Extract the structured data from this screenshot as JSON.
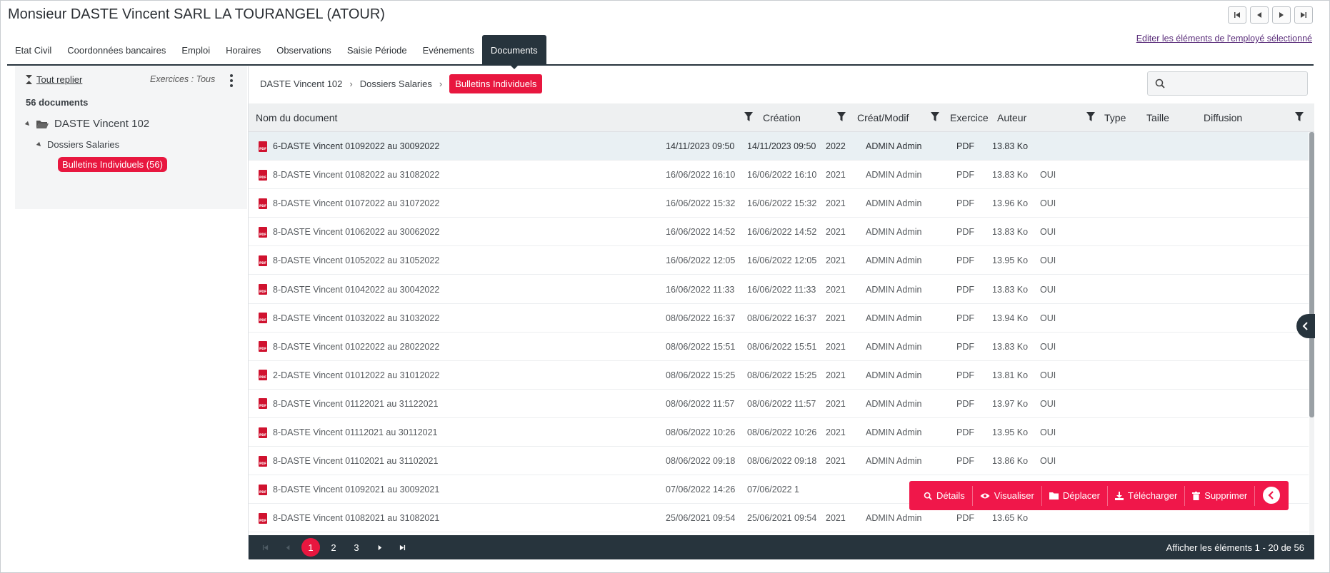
{
  "header": {
    "title": "Monsieur DASTE Vincent SARL LA TOURANGEL (ATOUR)",
    "edit_link": "Editer les éléments de l'employé sélectionné"
  },
  "tabs": [
    {
      "label": "Etat Civil"
    },
    {
      "label": "Coordonnées bancaires"
    },
    {
      "label": "Emploi"
    },
    {
      "label": "Horaires"
    },
    {
      "label": "Observations"
    },
    {
      "label": "Saisie Période"
    },
    {
      "label": "Evénements"
    },
    {
      "label": "Documents",
      "active": true
    }
  ],
  "left_panel": {
    "collapse_label": "Tout replier",
    "exercices_label": "Exercices : Tous",
    "doc_count": "56 documents",
    "tree": {
      "root": "DASTE Vincent 102",
      "child": "Dossiers Salaries",
      "leaf": "Bulletins Individuels (56)"
    }
  },
  "breadcrumb": {
    "items": [
      "DASTE Vincent 102",
      "Dossiers Salaries"
    ],
    "active": "Bulletins Individuels"
  },
  "search": {
    "value": "",
    "placeholder": ""
  },
  "table": {
    "columns": {
      "name": "Nom du document",
      "creation": "Création",
      "modif": "Créat/Modif",
      "exercice": "Exercice",
      "auteur": "Auteur",
      "type": "Type",
      "taille": "Taille",
      "diffusion": "Diffusion"
    },
    "rows": [
      {
        "name": "6-DASTE Vincent 01092022 au 30092022",
        "creation": "14/11/2023 09:50",
        "modif": "14/11/2023 09:50",
        "exercice": "2022",
        "auteur": "ADMIN Admin",
        "type": "PDF",
        "taille": "13.83 Ko",
        "diffusion": ""
      },
      {
        "name": "8-DASTE Vincent 01082022 au 31082022",
        "creation": "16/06/2022 16:10",
        "modif": "16/06/2022 16:10",
        "exercice": "2021",
        "auteur": "ADMIN Admin",
        "type": "PDF",
        "taille": "13.83 Ko",
        "diffusion": "OUI"
      },
      {
        "name": "8-DASTE Vincent 01072022 au 31072022",
        "creation": "16/06/2022 15:32",
        "modif": "16/06/2022 15:32",
        "exercice": "2021",
        "auteur": "ADMIN Admin",
        "type": "PDF",
        "taille": "13.96 Ko",
        "diffusion": "OUI"
      },
      {
        "name": "8-DASTE Vincent 01062022 au 30062022",
        "creation": "16/06/2022 14:52",
        "modif": "16/06/2022 14:52",
        "exercice": "2021",
        "auteur": "ADMIN Admin",
        "type": "PDF",
        "taille": "13.83 Ko",
        "diffusion": "OUI"
      },
      {
        "name": "8-DASTE Vincent 01052022 au 31052022",
        "creation": "16/06/2022 12:05",
        "modif": "16/06/2022 12:05",
        "exercice": "2021",
        "auteur": "ADMIN Admin",
        "type": "PDF",
        "taille": "13.95 Ko",
        "diffusion": "OUI"
      },
      {
        "name": "8-DASTE Vincent 01042022 au 30042022",
        "creation": "16/06/2022 11:33",
        "modif": "16/06/2022 11:33",
        "exercice": "2021",
        "auteur": "ADMIN Admin",
        "type": "PDF",
        "taille": "13.83 Ko",
        "diffusion": "OUI"
      },
      {
        "name": "8-DASTE Vincent 01032022 au 31032022",
        "creation": "08/06/2022 16:37",
        "modif": "08/06/2022 16:37",
        "exercice": "2021",
        "auteur": "ADMIN Admin",
        "type": "PDF",
        "taille": "13.94 Ko",
        "diffusion": "OUI"
      },
      {
        "name": "8-DASTE Vincent 01022022 au 28022022",
        "creation": "08/06/2022 15:51",
        "modif": "08/06/2022 15:51",
        "exercice": "2021",
        "auteur": "ADMIN Admin",
        "type": "PDF",
        "taille": "13.83 Ko",
        "diffusion": "OUI"
      },
      {
        "name": "2-DASTE Vincent 01012022 au 31012022",
        "creation": "08/06/2022 15:25",
        "modif": "08/06/2022 15:25",
        "exercice": "2021",
        "auteur": "ADMIN Admin",
        "type": "PDF",
        "taille": "13.81 Ko",
        "diffusion": "OUI"
      },
      {
        "name": "8-DASTE Vincent 01122021 au 31122021",
        "creation": "08/06/2022 11:57",
        "modif": "08/06/2022 11:57",
        "exercice": "2021",
        "auteur": "ADMIN Admin",
        "type": "PDF",
        "taille": "13.97 Ko",
        "diffusion": "OUI"
      },
      {
        "name": "8-DASTE Vincent 01112021 au 30112021",
        "creation": "08/06/2022 10:26",
        "modif": "08/06/2022 10:26",
        "exercice": "2021",
        "auteur": "ADMIN Admin",
        "type": "PDF",
        "taille": "13.95 Ko",
        "diffusion": "OUI"
      },
      {
        "name": "8-DASTE Vincent 01102021 au 31102021",
        "creation": "08/06/2022 09:18",
        "modif": "08/06/2022 09:18",
        "exercice": "2021",
        "auteur": "ADMIN Admin",
        "type": "PDF",
        "taille": "13.86 Ko",
        "diffusion": "OUI"
      },
      {
        "name": "8-DASTE Vincent 01092021 au 30092021",
        "creation": "07/06/2022 14:26",
        "modif": "07/06/2022 1",
        "exercice": "",
        "auteur": "",
        "type": "",
        "taille": "",
        "diffusion": ""
      },
      {
        "name": "8-DASTE Vincent 01082021 au 31082021",
        "creation": "25/06/2021 09:54",
        "modif": "25/06/2021 09:54",
        "exercice": "2021",
        "auteur": "ADMIN Admin",
        "type": "PDF",
        "taille": "13.65 Ko",
        "diffusion": ""
      }
    ]
  },
  "actions": {
    "details": "Détails",
    "visualiser": "Visualiser",
    "deplacer": "Déplacer",
    "telecharger": "Télécharger",
    "supprimer": "Supprimer"
  },
  "pagination": {
    "pages": [
      "1",
      "2",
      "3"
    ],
    "current": "1",
    "info": "Afficher les éléments 1 - 20 de 56"
  },
  "colors": {
    "accent": "#e8173f",
    "dark": "#27343d",
    "action_bar": "#f0174a"
  }
}
